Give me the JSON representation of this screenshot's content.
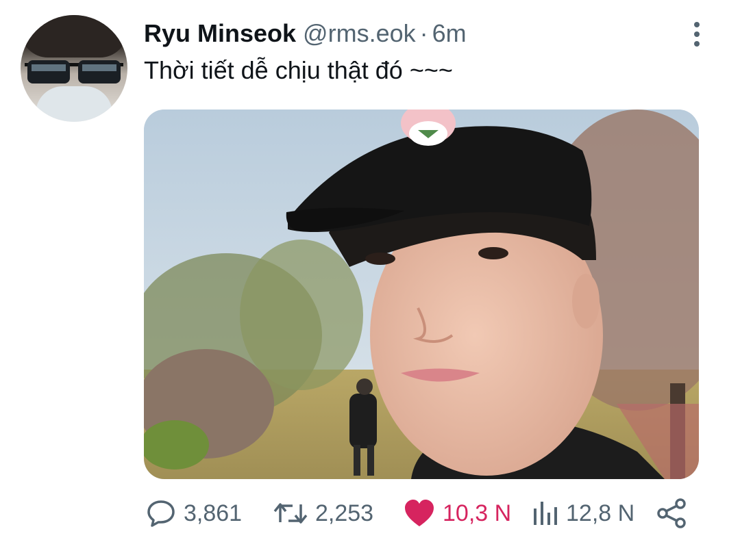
{
  "tweet": {
    "author_name": "Ryu Minseok",
    "handle": "@rms.eok",
    "separator": "·",
    "time": "6m",
    "text": "Thời tiết dễ chịu thật đó ~~~"
  },
  "actions": {
    "replies": "3,861",
    "retweets": "2,253",
    "likes": "10,3 N",
    "views": "12,8 N"
  },
  "colors": {
    "text_primary": "#0f1419",
    "text_secondary": "#536471",
    "like_active": "#d6245f"
  },
  "icons": {
    "more": "more-vertical-icon",
    "reply": "speech-bubble-icon",
    "retweet": "retweet-icon",
    "like": "heart-filled-icon",
    "views": "bar-chart-icon",
    "share": "share-icon"
  }
}
